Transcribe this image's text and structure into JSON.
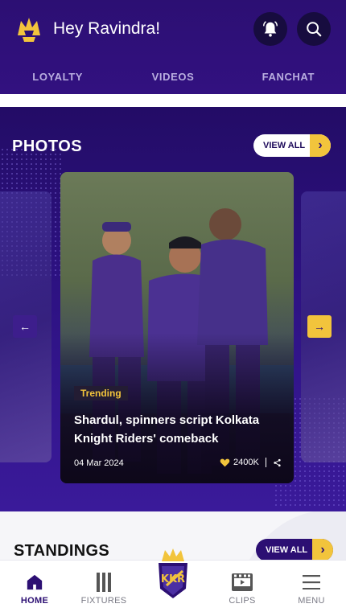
{
  "header": {
    "greeting": "Hey Ravindra!",
    "logo_icon": "kkr-helmet-icon",
    "tabs": [
      {
        "label": "LOYALTY"
      },
      {
        "label": "VIDEOS"
      },
      {
        "label": "FANCHAT"
      }
    ]
  },
  "photos": {
    "title": "PHOTOS",
    "view_all": "VIEW ALL",
    "card": {
      "tag": "Trending",
      "title": "Shardul, spinners script Kolkata Knight Riders' comeback",
      "date": "04 Mar 2024",
      "likes": "2400K"
    },
    "prev_arrow": "←",
    "next_arrow": "→"
  },
  "standings": {
    "title": "STANDINGS",
    "view_all": "VIEW ALL"
  },
  "bottom_nav": {
    "items": [
      {
        "label": "HOME",
        "icon": "home-icon",
        "active": true
      },
      {
        "label": "FIXTURES",
        "icon": "stumps-icon"
      },
      {
        "label": "",
        "icon": "kkr-logo"
      },
      {
        "label": "CLIPS",
        "icon": "film-icon"
      },
      {
        "label": "MENU",
        "icon": "hamburger-icon"
      }
    ]
  },
  "colors": {
    "primary": "#2c0f73",
    "accent": "#f2c43c",
    "background": "#ffffff"
  }
}
